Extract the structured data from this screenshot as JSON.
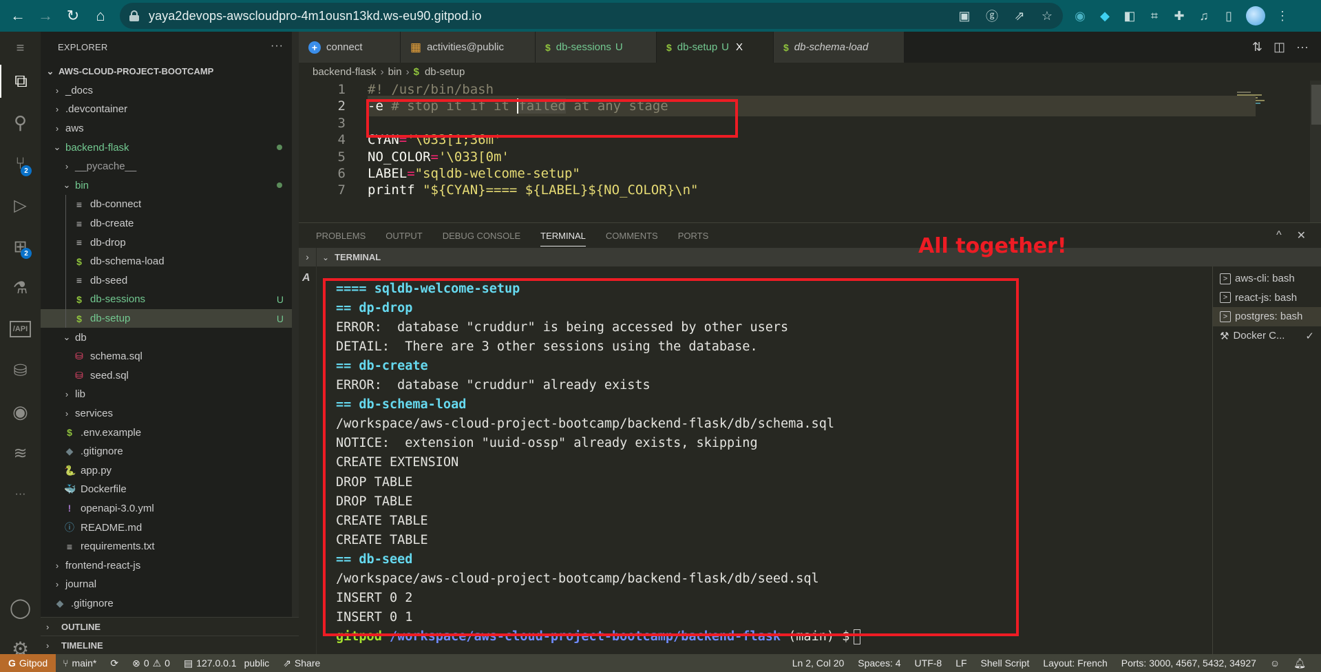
{
  "browser": {
    "url": "yaya2devops-awscloudpro-4m1ousn13kd.ws-eu90.gitpod.io",
    "nav": {
      "back": "←",
      "forward": "→",
      "reload": "↻",
      "home": "⌂"
    },
    "omnibox_icons": [
      "ad-block-icon",
      "translate-icon",
      "share-icon",
      "bookmark-star-icon"
    ],
    "extension_icons": [
      "extension-1-icon",
      "extension-2-icon",
      "extension-3-icon",
      "screenshot-icon",
      "puzzle-icon",
      "media-icon",
      "sidepanel-icon"
    ],
    "menu": "⋮"
  },
  "activity_bar": {
    "items": [
      {
        "name": "menu",
        "glyph": "≡"
      },
      {
        "name": "explorer",
        "glyph": "⧉",
        "active": true
      },
      {
        "name": "search",
        "glyph": "⚲"
      },
      {
        "name": "source-control",
        "glyph": "⑂",
        "badge": "2"
      },
      {
        "name": "run-debug",
        "glyph": "▷"
      },
      {
        "name": "extensions",
        "glyph": "⊞",
        "badge": "2"
      },
      {
        "name": "testing",
        "glyph": "⚗"
      },
      {
        "name": "api",
        "glyph": "/API"
      },
      {
        "name": "database",
        "glyph": "⛁"
      },
      {
        "name": "github",
        "glyph": "◉"
      },
      {
        "name": "redis",
        "glyph": "≋"
      },
      {
        "name": "more",
        "glyph": "···"
      },
      {
        "name": "accounts",
        "glyph": "◯"
      },
      {
        "name": "manage",
        "glyph": "⚙"
      }
    ]
  },
  "explorer": {
    "title": "EXPLORER",
    "more": "···",
    "root": "AWS-CLOUD-PROJECT-BOOTCAMP",
    "tree": [
      {
        "label": "_docs",
        "type": "folder",
        "depth": 1,
        "open": false
      },
      {
        "label": ".devcontainer",
        "type": "folder",
        "depth": 1,
        "open": false
      },
      {
        "label": "aws",
        "type": "folder",
        "depth": 1,
        "open": false
      },
      {
        "label": "backend-flask",
        "type": "folder",
        "depth": 1,
        "open": true,
        "status": "dot",
        "green": true
      },
      {
        "label": "__pycache__",
        "type": "folder",
        "depth": 2,
        "open": false,
        "dim": true
      },
      {
        "label": "bin",
        "type": "folder",
        "depth": 2,
        "open": true,
        "status": "dot",
        "green": true
      },
      {
        "label": "db-connect",
        "type": "file",
        "icon": "≡",
        "depth": 3
      },
      {
        "label": "db-create",
        "type": "file",
        "icon": "≡",
        "depth": 3
      },
      {
        "label": "db-drop",
        "type": "file",
        "icon": "≡",
        "depth": 3
      },
      {
        "label": "db-schema-load",
        "type": "file",
        "icon": "$",
        "depth": 3
      },
      {
        "label": "db-seed",
        "type": "file",
        "icon": "≡",
        "depth": 3
      },
      {
        "label": "db-sessions",
        "type": "file",
        "icon": "$",
        "depth": 3,
        "status": "U",
        "green": true
      },
      {
        "label": "db-setup",
        "type": "file",
        "icon": "$",
        "depth": 3,
        "status": "U",
        "green": true,
        "selected": true
      },
      {
        "label": "db",
        "type": "folder",
        "depth": 2,
        "open": true
      },
      {
        "label": "schema.sql",
        "type": "file",
        "icon": "⛁",
        "depth": 3
      },
      {
        "label": "seed.sql",
        "type": "file",
        "icon": "⛁",
        "depth": 3
      },
      {
        "label": "lib",
        "type": "folder",
        "depth": 2,
        "open": false
      },
      {
        "label": "services",
        "type": "folder",
        "depth": 2,
        "open": false
      },
      {
        "label": ".env.example",
        "type": "file",
        "icon": "$",
        "depth": 2
      },
      {
        "label": ".gitignore",
        "type": "file",
        "icon": "◆",
        "depth": 2
      },
      {
        "label": "app.py",
        "type": "file",
        "icon": "🐍",
        "depth": 2
      },
      {
        "label": "Dockerfile",
        "type": "file",
        "icon": "🐳",
        "depth": 2
      },
      {
        "label": "openapi-3.0.yml",
        "type": "file",
        "icon": "!",
        "depth": 2
      },
      {
        "label": "README.md",
        "type": "file",
        "icon": "ⓘ",
        "depth": 2
      },
      {
        "label": "requirements.txt",
        "type": "file",
        "icon": "≡",
        "depth": 2
      },
      {
        "label": "frontend-react-js",
        "type": "folder",
        "depth": 1,
        "open": false
      },
      {
        "label": "journal",
        "type": "folder",
        "depth": 1,
        "open": false
      },
      {
        "label": ".gitignore",
        "type": "file",
        "icon": "◆",
        "depth": 1
      }
    ],
    "sections": [
      "OUTLINE",
      "TIMELINE"
    ]
  },
  "editor": {
    "tabs": [
      {
        "label": "connect",
        "icon": "+",
        "icon_name": "connect-icon"
      },
      {
        "label": "activities@public",
        "icon": "▦",
        "icon_name": "table-icon"
      },
      {
        "label": "db-sessions",
        "icon": "$",
        "icon_name": "shell-icon",
        "modified": "U"
      },
      {
        "label": "db-setup",
        "icon": "$",
        "icon_name": "shell-icon",
        "modified": "U",
        "active": true,
        "close": "X"
      },
      {
        "label": "db-schema-load",
        "icon": "$",
        "icon_name": "shell-icon",
        "preview": true
      }
    ],
    "actions": {
      "compare": "⇅",
      "split": "◫",
      "more": "···"
    },
    "breadcrumb": [
      "backend-flask",
      "bin",
      "db-setup"
    ],
    "lines": [
      {
        "n": "1",
        "tokens": [
          {
            "t": "#! /usr/bin/bash",
            "c": "comment"
          }
        ]
      },
      {
        "n": "2",
        "tokens": [
          {
            "t": "-e",
            "c": "plain"
          },
          {
            "t": " # stop it if it ",
            "c": "comment"
          },
          {
            "t": "failed",
            "c": "comment-sel"
          },
          {
            "t": " at any stage",
            "c": "comment"
          }
        ],
        "current": true
      },
      {
        "n": "3",
        "tokens": []
      },
      {
        "n": "4",
        "tokens": [
          {
            "t": "CYAN",
            "c": "plain"
          },
          {
            "t": "=",
            "c": "op"
          },
          {
            "t": "'\\033[1;36m'",
            "c": "str"
          }
        ]
      },
      {
        "n": "5",
        "tokens": [
          {
            "t": "NO_COLOR",
            "c": "plain"
          },
          {
            "t": "=",
            "c": "op"
          },
          {
            "t": "'\\033[0m'",
            "c": "str"
          }
        ]
      },
      {
        "n": "6",
        "tokens": [
          {
            "t": "LABEL",
            "c": "plain"
          },
          {
            "t": "=",
            "c": "op"
          },
          {
            "t": "\"sqldb-welcome-setup\"",
            "c": "str"
          }
        ]
      },
      {
        "n": "7",
        "tokens": [
          {
            "t": "printf ",
            "c": "plain"
          },
          {
            "t": "\"${CYAN}==== ${LABEL}${NO_COLOR}\\n\"",
            "c": "str"
          }
        ]
      }
    ]
  },
  "panel": {
    "tabs": [
      "PROBLEMS",
      "OUTPUT",
      "DEBUG CONSOLE",
      "TERMINAL",
      "COMMENTS",
      "PORTS"
    ],
    "active_tab": "TERMINAL",
    "actions": {
      "maximize": "^",
      "close": "✕"
    },
    "section_title": "TERMINAL",
    "output": [
      {
        "text": "==== sqldb-welcome-setup",
        "style": "cyan"
      },
      {
        "text": "== dp-drop",
        "style": "cyan"
      },
      {
        "text": "ERROR:  database \"cruddur\" is being accessed by other users",
        "style": "plain"
      },
      {
        "text": "DETAIL:  There are 3 other sessions using the database.",
        "style": "plain"
      },
      {
        "text": "== db-create",
        "style": "cyan"
      },
      {
        "text": "ERROR:  database \"cruddur\" already exists",
        "style": "plain"
      },
      {
        "text": "== db-schema-load",
        "style": "cyan"
      },
      {
        "text": "/workspace/aws-cloud-project-bootcamp/backend-flask/db/schema.sql",
        "style": "plain"
      },
      {
        "text": "NOTICE:  extension \"uuid-ossp\" already exists, skipping",
        "style": "plain"
      },
      {
        "text": "CREATE EXTENSION",
        "style": "plain"
      },
      {
        "text": "DROP TABLE",
        "style": "plain"
      },
      {
        "text": "DROP TABLE",
        "style": "plain"
      },
      {
        "text": "CREATE TABLE",
        "style": "plain"
      },
      {
        "text": "CREATE TABLE",
        "style": "plain"
      },
      {
        "text": "== db-seed",
        "style": "cyan"
      },
      {
        "text": "/workspace/aws-cloud-project-bootcamp/backend-flask/db/seed.sql",
        "style": "plain"
      },
      {
        "text": "INSERT 0 2",
        "style": "plain"
      },
      {
        "text": "INSERT 0 1",
        "style": "plain"
      }
    ],
    "prompt": {
      "user": "gitpod",
      "path": "/workspace/aws-cloud-project-bootcamp/backend-flask",
      "branch": "(main)",
      "symbol": "$"
    },
    "terminals": [
      {
        "label": "aws-cli: bash",
        "icon": ">"
      },
      {
        "label": "react-js: bash",
        "icon": ">"
      },
      {
        "label": "postgres: bash",
        "icon": ">",
        "active": true
      },
      {
        "label": "Docker C...",
        "icon": "tools",
        "check": "✓"
      }
    ]
  },
  "annotation": {
    "label": "All together!",
    "color": "#ed1c24"
  },
  "statusbar": {
    "gitpod": "Gitpod",
    "branch": "main*",
    "sync": "⟳",
    "errors": "0",
    "warnings": "0",
    "server": "127.0.0.1",
    "server_label": "public",
    "share": "Share",
    "position": "Ln 2, Col 20",
    "spaces": "Spaces: 4",
    "encoding": "UTF-8",
    "eol": "LF",
    "language": "Shell Script",
    "layout": "Layout: French",
    "ports": "Ports: 3000, 4567, 5432, 34927",
    "feedback": "☺",
    "bell": "🔔"
  }
}
